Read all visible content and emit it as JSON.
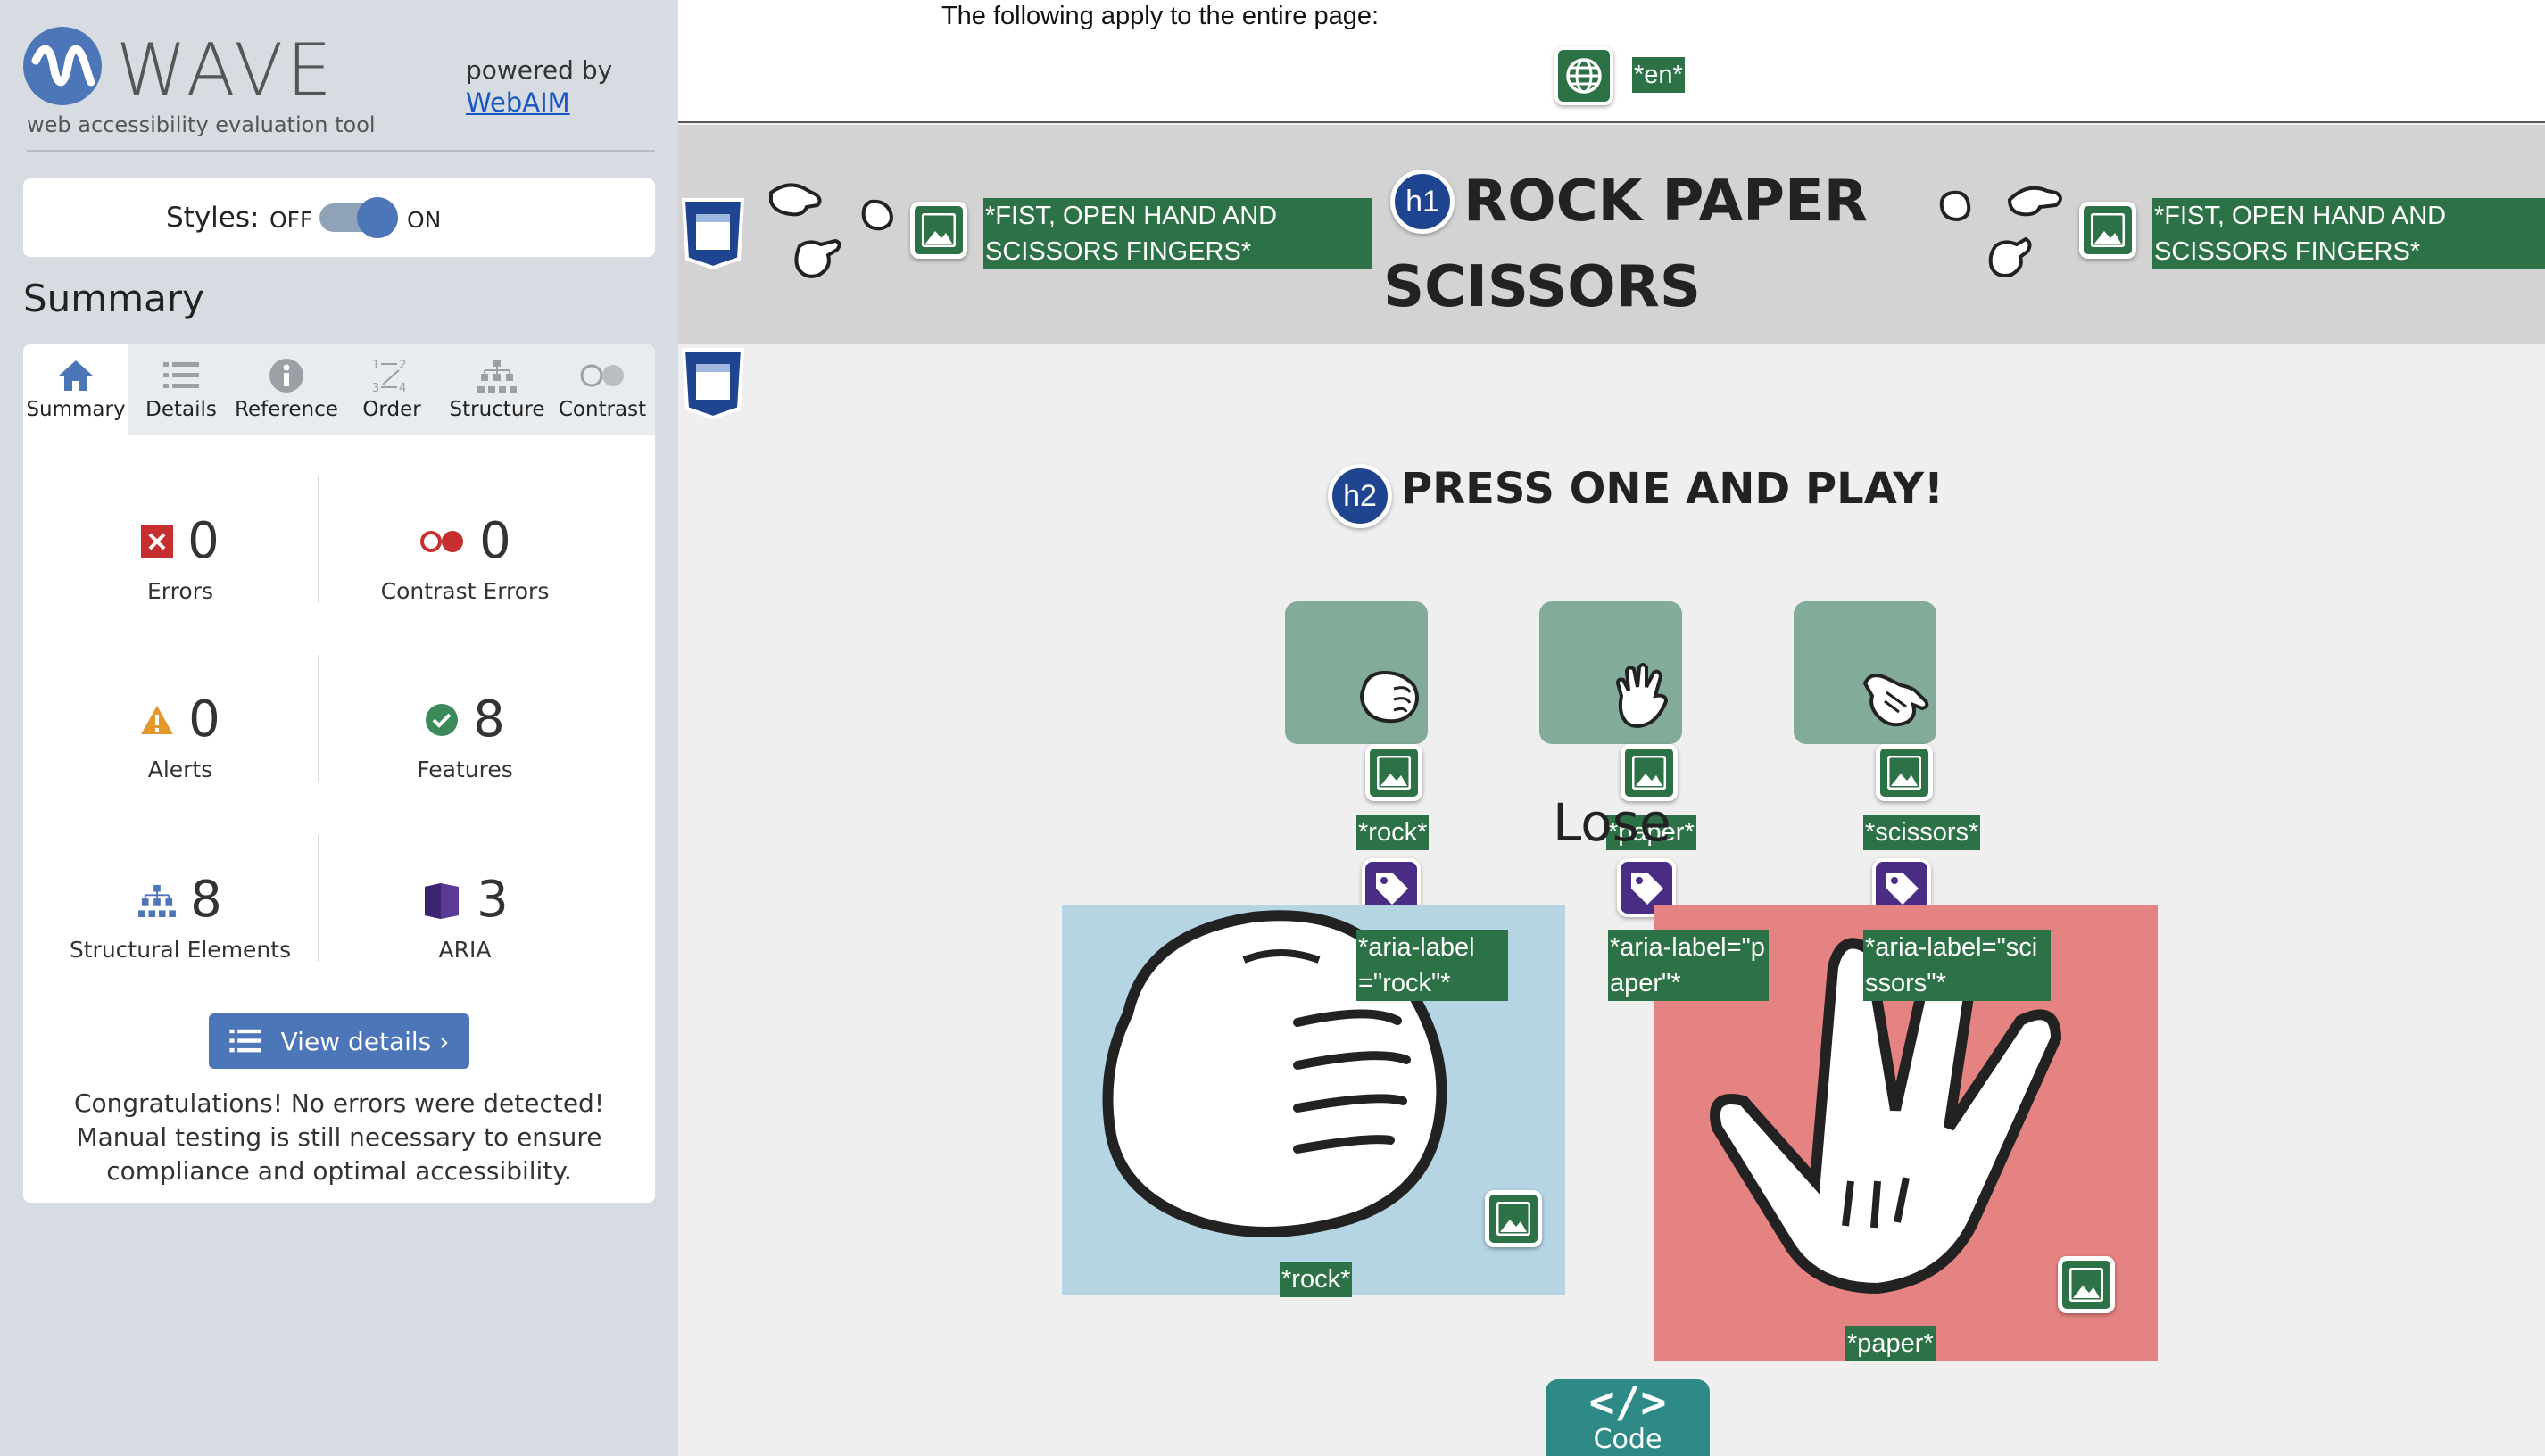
{
  "wave": {
    "logo_text": "WAVE",
    "tagline": "web accessibility evaluation tool",
    "powered_by": "powered by",
    "webaim_link": "WebAIM",
    "styles_label": "Styles:",
    "off_label": "OFF",
    "on_label": "ON",
    "styles_on": true,
    "section_title": "Summary",
    "tabs": [
      {
        "label": "Summary",
        "icon": "home-icon",
        "active": true
      },
      {
        "label": "Details",
        "icon": "list-icon"
      },
      {
        "label": "Reference",
        "icon": "info-icon"
      },
      {
        "label": "Order",
        "icon": "order-icon"
      },
      {
        "label": "Structure",
        "icon": "structure-icon"
      },
      {
        "label": "Contrast",
        "icon": "contrast-icon"
      }
    ],
    "stats": {
      "errors": {
        "count": "0",
        "label": "Errors"
      },
      "contrast_errors": {
        "count": "0",
        "label": "Contrast Errors"
      },
      "alerts": {
        "count": "0",
        "label": "Alerts"
      },
      "features": {
        "count": "8",
        "label": "Features"
      },
      "structural": {
        "count": "8",
        "label": "Structural Elements"
      },
      "aria": {
        "count": "3",
        "label": "ARIA"
      }
    },
    "view_details": "View details ›",
    "message": "Congratulations! No errors were detected! Manual testing is still necessary to ensure compliance and optimal accessibility."
  },
  "page": {
    "page_wide_note": "The following apply to the entire page:",
    "lang_badge": "*en*",
    "header_alt": "*FIST, OPEN HAND AND SCISSORS FINGERS*",
    "h1_badge": "h1",
    "h1_line1": "ROCK PAPER",
    "h1_line2": "SCISSORS",
    "h2_badge": "h2",
    "h2_text": "PRESS ONE AND PLAY!",
    "choices": [
      {
        "alt": "*rock*",
        "aria": "*aria-label=\"rock\"*"
      },
      {
        "alt": "*paper*",
        "aria": "*aria-label=\"paper\"*"
      },
      {
        "alt": "*scissors*",
        "aria": "*aria-label=\"scissors\"*"
      }
    ],
    "result_text": "Lose",
    "player_alt": "*rock*",
    "computer_alt": "*paper*",
    "code_button": "Code",
    "colors": {
      "header_bg": "#d3d3d3",
      "choice_bg": "#82ab99",
      "player_bg": "#b5d5e2",
      "computer_bg": "#e58382",
      "badge_green": "#2d7246",
      "wave_blue": "#4d76b9"
    }
  }
}
